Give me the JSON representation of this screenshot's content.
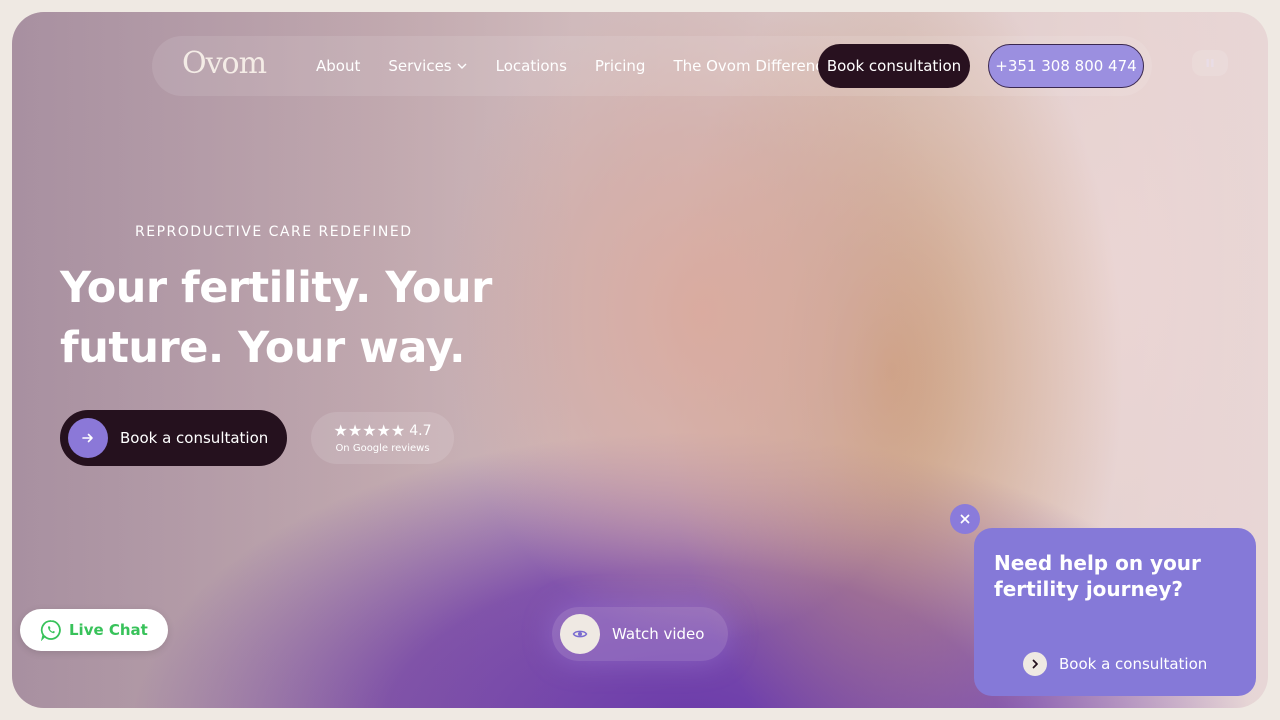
{
  "header": {
    "logo": "Ovom",
    "nav": [
      "About",
      "Services",
      "Locations",
      "Pricing",
      "The Ovom Difference"
    ],
    "book_label": "Book consultation",
    "phone": "+351 308 800 474"
  },
  "hero": {
    "eyebrow": "REPRODUCTIVE CARE REDEFINED",
    "headline": "Your fertility. Your future. Your way.",
    "cta_label": "Book a consultation",
    "rating": {
      "score": "4.7",
      "stars": "★★★★★",
      "source": "On Google reviews"
    },
    "watch_label": "Watch video"
  },
  "live_chat": {
    "label": "Live Chat"
  },
  "help_popup": {
    "title": "Need help on your fertility journey?",
    "cta_label": "Book a consultation"
  },
  "icons": [
    "chevron-down-icon",
    "pause-icon",
    "arrow-right-icon",
    "eye-icon",
    "whatsapp-icon",
    "close-icon",
    "chevron-right-icon"
  ],
  "colors": {
    "dark_plum": "#25111e",
    "lavender": "#8579d8",
    "whatsapp_green": "#38c25a",
    "cream": "#efe9e3"
  }
}
